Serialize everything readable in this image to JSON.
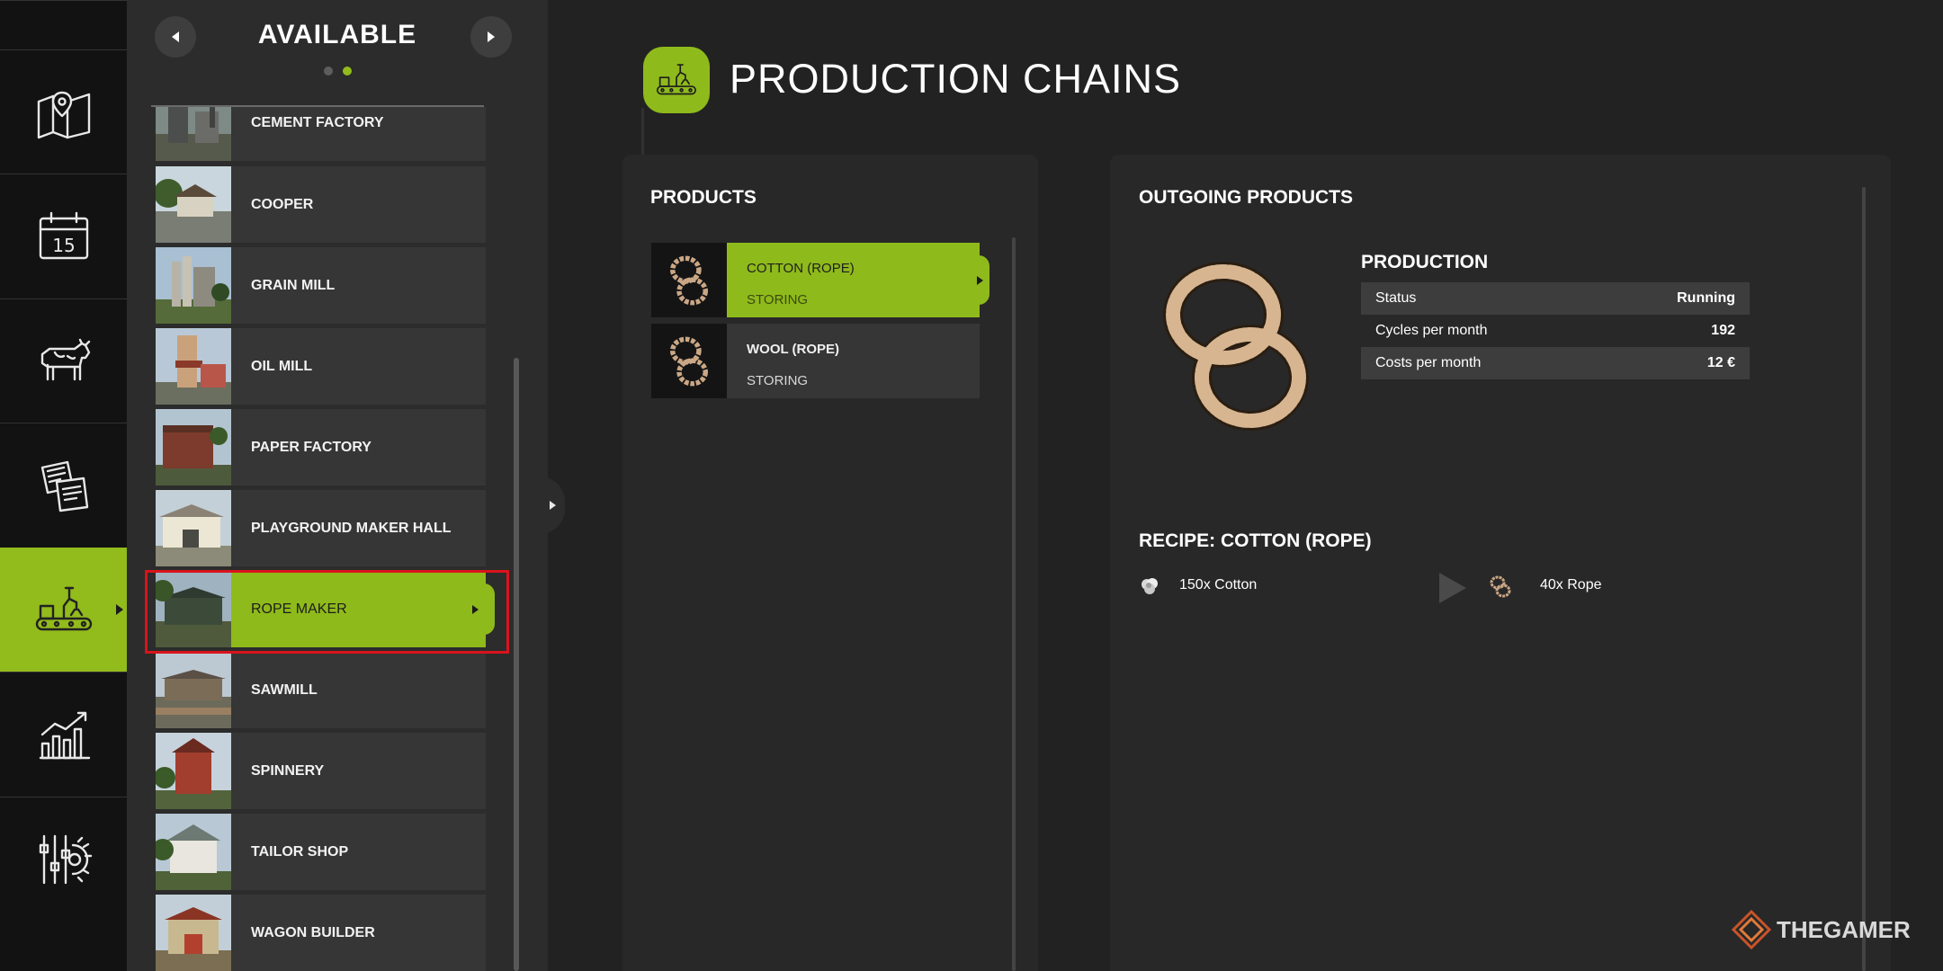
{
  "sidebar": {
    "items": [
      {
        "icon": "map-icon",
        "active": false
      },
      {
        "icon": "calendar-icon",
        "label": "15",
        "active": false
      },
      {
        "icon": "cow-icon",
        "active": false
      },
      {
        "icon": "contracts-icon",
        "active": false
      },
      {
        "icon": "production-icon",
        "active": true
      },
      {
        "icon": "stats-chart-icon",
        "active": false
      },
      {
        "icon": "settings-sliders-icon",
        "active": false
      }
    ]
  },
  "list": {
    "title": "AVAILABLE",
    "page_dots": 2,
    "active_page": 2,
    "items": [
      {
        "label": "CEMENT FACTORY",
        "selected": false
      },
      {
        "label": "COOPER",
        "selected": false
      },
      {
        "label": "GRAIN MILL",
        "selected": false
      },
      {
        "label": "OIL MILL",
        "selected": false
      },
      {
        "label": "PAPER FACTORY",
        "selected": false
      },
      {
        "label": "PLAYGROUND MAKER HALL",
        "selected": false
      },
      {
        "label": "ROPE MAKER",
        "selected": true
      },
      {
        "label": "SAWMILL",
        "selected": false
      },
      {
        "label": "SPINNERY",
        "selected": false
      },
      {
        "label": "TAILOR SHOP",
        "selected": false
      },
      {
        "label": "WAGON BUILDER",
        "selected": false
      }
    ]
  },
  "header": {
    "title": "PRODUCTION CHAINS",
    "icon": "production-icon"
  },
  "products": {
    "title": "PRODUCTS",
    "items": [
      {
        "name": "COTTON (ROPE)",
        "state": "STORING",
        "selected": true
      },
      {
        "name": "WOOL (ROPE)",
        "state": "STORING",
        "selected": false
      }
    ]
  },
  "outgoing": {
    "title": "OUTGOING PRODUCTS",
    "production": {
      "title": "PRODUCTION",
      "rows": [
        {
          "label": "Status",
          "value": "Running"
        },
        {
          "label": "Cycles per month",
          "value": "192"
        },
        {
          "label": "Costs per month",
          "value": "12 €"
        }
      ]
    },
    "recipe": {
      "title": "RECIPE: COTTON (ROPE)",
      "input": "150x Cotton",
      "output": "40x Rope"
    }
  },
  "watermark": {
    "text": "THEGAMER"
  },
  "colors": {
    "accent": "#8fba1b",
    "highlight_outline": "#d9131d",
    "panel": "#282828",
    "rail": "#121212"
  }
}
